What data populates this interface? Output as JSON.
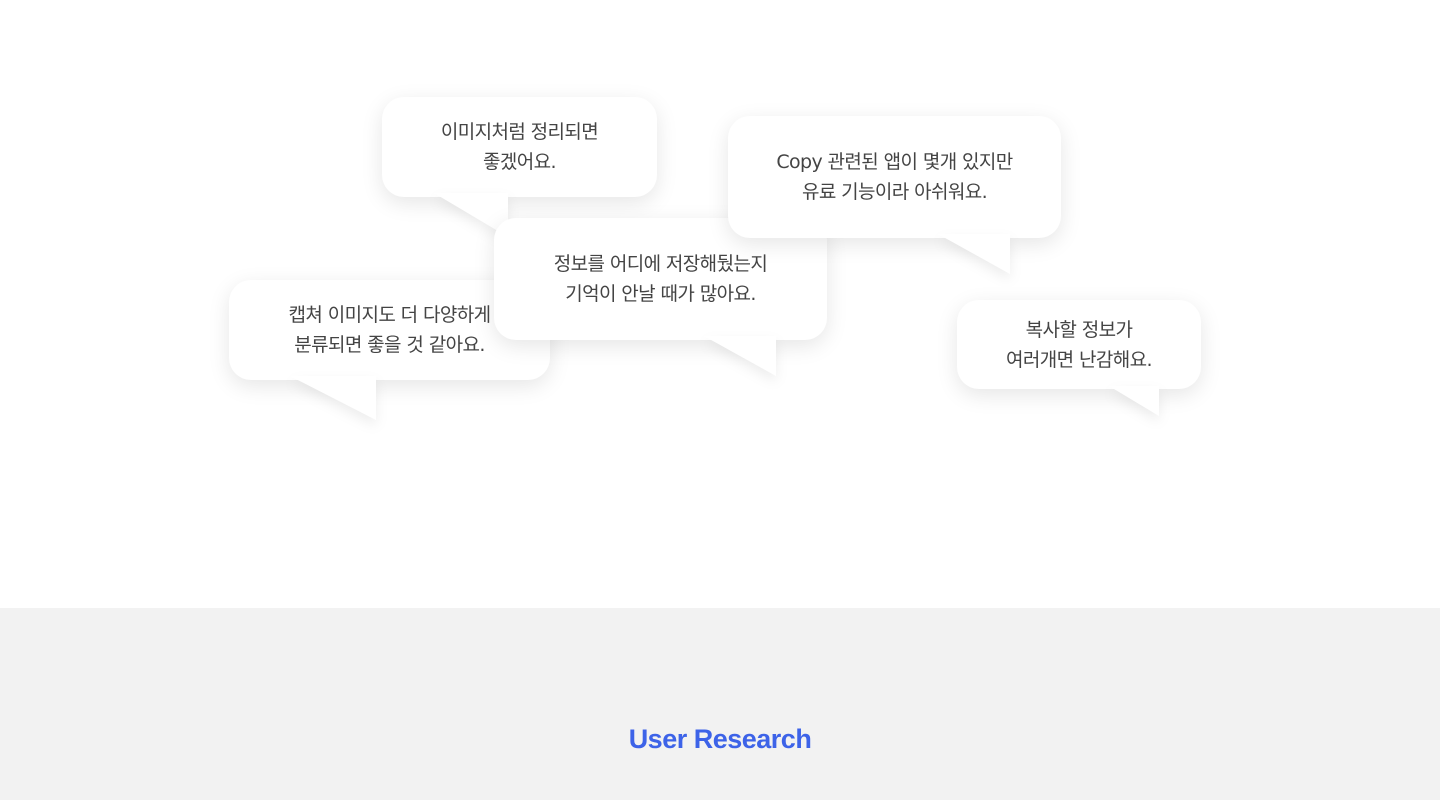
{
  "quotes": [
    {
      "lines": [
        "이미지처럼 정리되면",
        "좋겠어요."
      ]
    },
    {
      "lines": [
        "Copy 관련된 앱이 몇개 있지만",
        "유료 기능이라 아쉬워요."
      ]
    },
    {
      "lines": [
        "정보를 어디에 저장해뒀는지",
        "기억이 안날 때가 많아요."
      ]
    },
    {
      "lines": [
        "캡쳐 이미지도 더 다양하게",
        "분류되면 좋을 것 같아요."
      ]
    },
    {
      "lines": [
        "복사할 정보가",
        "여러개면 난감해요."
      ]
    }
  ],
  "section": {
    "title": "User Research"
  },
  "colors": {
    "accent": "#3d63e8",
    "bottom_background": "#f2f2f2",
    "bubble_text": "#444444"
  }
}
